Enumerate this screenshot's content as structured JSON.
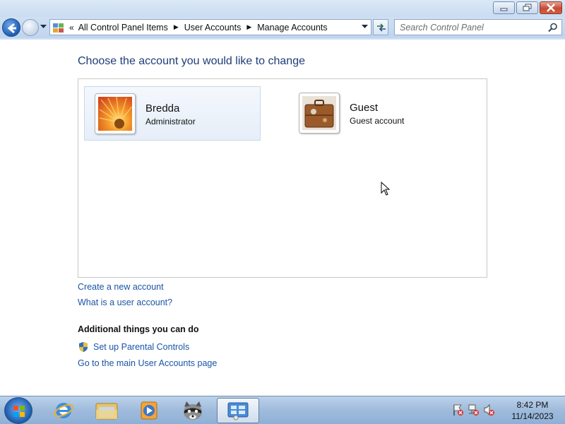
{
  "window": {
    "minimize_icon": "minimize-icon",
    "maximize_icon": "restore-icon",
    "close_icon": "close-icon"
  },
  "address_bar": {
    "overflow": "«",
    "crumbs": [
      "All Control Panel Items",
      "User Accounts",
      "Manage Accounts"
    ]
  },
  "search": {
    "placeholder": "Search Control Panel"
  },
  "main": {
    "title": "Choose the account you would like to change",
    "accounts": [
      {
        "name": "Bredda",
        "type": "Administrator",
        "picture": "orange-flower",
        "selected": true
      },
      {
        "name": "Guest",
        "type": "Guest account",
        "picture": "suitcase",
        "selected": false
      }
    ],
    "links": {
      "create_account": "Create a new account",
      "what_is_account": "What is a user account?"
    },
    "additional": {
      "heading": "Additional things you can do",
      "parental_controls": "Set up Parental Controls",
      "main_page": "Go to the main User Accounts page"
    }
  },
  "taskbar": {
    "apps": [
      "internet-explorer",
      "windows-explorer",
      "media-player",
      "raccoon-app",
      "control-panel"
    ],
    "clock_time": "8:42 PM",
    "clock_date": "11/14/2023"
  },
  "colors": {
    "link": "#1a54a6",
    "title": "#1e3d78",
    "taskbar": "#9fbbdc"
  }
}
